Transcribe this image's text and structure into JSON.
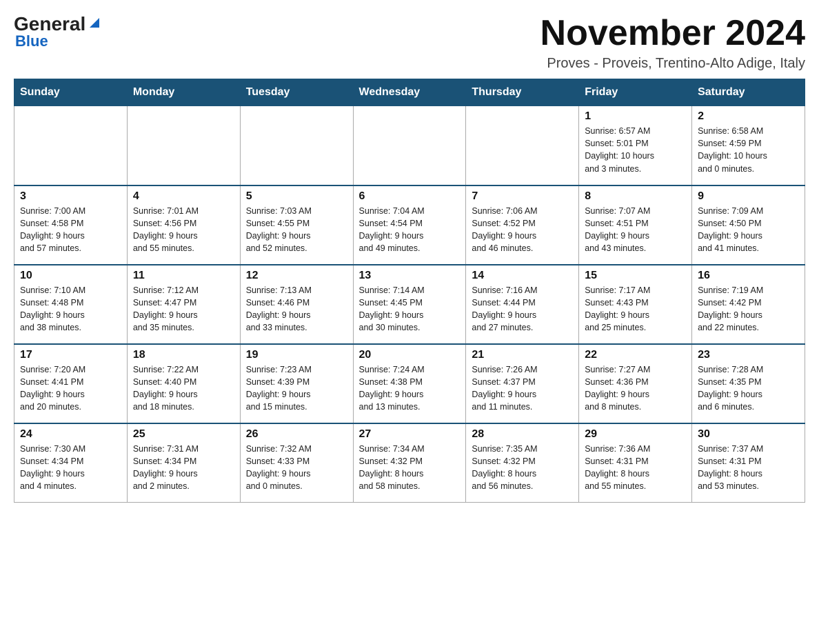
{
  "header": {
    "logo_general": "General",
    "logo_blue": "Blue",
    "month_title": "November 2024",
    "subtitle": "Proves - Proveis, Trentino-Alto Adige, Italy"
  },
  "days_of_week": [
    "Sunday",
    "Monday",
    "Tuesday",
    "Wednesday",
    "Thursday",
    "Friday",
    "Saturday"
  ],
  "weeks": [
    {
      "days": [
        {
          "number": "",
          "info": ""
        },
        {
          "number": "",
          "info": ""
        },
        {
          "number": "",
          "info": ""
        },
        {
          "number": "",
          "info": ""
        },
        {
          "number": "",
          "info": ""
        },
        {
          "number": "1",
          "info": "Sunrise: 6:57 AM\nSunset: 5:01 PM\nDaylight: 10 hours\nand 3 minutes."
        },
        {
          "number": "2",
          "info": "Sunrise: 6:58 AM\nSunset: 4:59 PM\nDaylight: 10 hours\nand 0 minutes."
        }
      ]
    },
    {
      "days": [
        {
          "number": "3",
          "info": "Sunrise: 7:00 AM\nSunset: 4:58 PM\nDaylight: 9 hours\nand 57 minutes."
        },
        {
          "number": "4",
          "info": "Sunrise: 7:01 AM\nSunset: 4:56 PM\nDaylight: 9 hours\nand 55 minutes."
        },
        {
          "number": "5",
          "info": "Sunrise: 7:03 AM\nSunset: 4:55 PM\nDaylight: 9 hours\nand 52 minutes."
        },
        {
          "number": "6",
          "info": "Sunrise: 7:04 AM\nSunset: 4:54 PM\nDaylight: 9 hours\nand 49 minutes."
        },
        {
          "number": "7",
          "info": "Sunrise: 7:06 AM\nSunset: 4:52 PM\nDaylight: 9 hours\nand 46 minutes."
        },
        {
          "number": "8",
          "info": "Sunrise: 7:07 AM\nSunset: 4:51 PM\nDaylight: 9 hours\nand 43 minutes."
        },
        {
          "number": "9",
          "info": "Sunrise: 7:09 AM\nSunset: 4:50 PM\nDaylight: 9 hours\nand 41 minutes."
        }
      ]
    },
    {
      "days": [
        {
          "number": "10",
          "info": "Sunrise: 7:10 AM\nSunset: 4:48 PM\nDaylight: 9 hours\nand 38 minutes."
        },
        {
          "number": "11",
          "info": "Sunrise: 7:12 AM\nSunset: 4:47 PM\nDaylight: 9 hours\nand 35 minutes."
        },
        {
          "number": "12",
          "info": "Sunrise: 7:13 AM\nSunset: 4:46 PM\nDaylight: 9 hours\nand 33 minutes."
        },
        {
          "number": "13",
          "info": "Sunrise: 7:14 AM\nSunset: 4:45 PM\nDaylight: 9 hours\nand 30 minutes."
        },
        {
          "number": "14",
          "info": "Sunrise: 7:16 AM\nSunset: 4:44 PM\nDaylight: 9 hours\nand 27 minutes."
        },
        {
          "number": "15",
          "info": "Sunrise: 7:17 AM\nSunset: 4:43 PM\nDaylight: 9 hours\nand 25 minutes."
        },
        {
          "number": "16",
          "info": "Sunrise: 7:19 AM\nSunset: 4:42 PM\nDaylight: 9 hours\nand 22 minutes."
        }
      ]
    },
    {
      "days": [
        {
          "number": "17",
          "info": "Sunrise: 7:20 AM\nSunset: 4:41 PM\nDaylight: 9 hours\nand 20 minutes."
        },
        {
          "number": "18",
          "info": "Sunrise: 7:22 AM\nSunset: 4:40 PM\nDaylight: 9 hours\nand 18 minutes."
        },
        {
          "number": "19",
          "info": "Sunrise: 7:23 AM\nSunset: 4:39 PM\nDaylight: 9 hours\nand 15 minutes."
        },
        {
          "number": "20",
          "info": "Sunrise: 7:24 AM\nSunset: 4:38 PM\nDaylight: 9 hours\nand 13 minutes."
        },
        {
          "number": "21",
          "info": "Sunrise: 7:26 AM\nSunset: 4:37 PM\nDaylight: 9 hours\nand 11 minutes."
        },
        {
          "number": "22",
          "info": "Sunrise: 7:27 AM\nSunset: 4:36 PM\nDaylight: 9 hours\nand 8 minutes."
        },
        {
          "number": "23",
          "info": "Sunrise: 7:28 AM\nSunset: 4:35 PM\nDaylight: 9 hours\nand 6 minutes."
        }
      ]
    },
    {
      "days": [
        {
          "number": "24",
          "info": "Sunrise: 7:30 AM\nSunset: 4:34 PM\nDaylight: 9 hours\nand 4 minutes."
        },
        {
          "number": "25",
          "info": "Sunrise: 7:31 AM\nSunset: 4:34 PM\nDaylight: 9 hours\nand 2 minutes."
        },
        {
          "number": "26",
          "info": "Sunrise: 7:32 AM\nSunset: 4:33 PM\nDaylight: 9 hours\nand 0 minutes."
        },
        {
          "number": "27",
          "info": "Sunrise: 7:34 AM\nSunset: 4:32 PM\nDaylight: 8 hours\nand 58 minutes."
        },
        {
          "number": "28",
          "info": "Sunrise: 7:35 AM\nSunset: 4:32 PM\nDaylight: 8 hours\nand 56 minutes."
        },
        {
          "number": "29",
          "info": "Sunrise: 7:36 AM\nSunset: 4:31 PM\nDaylight: 8 hours\nand 55 minutes."
        },
        {
          "number": "30",
          "info": "Sunrise: 7:37 AM\nSunset: 4:31 PM\nDaylight: 8 hours\nand 53 minutes."
        }
      ]
    }
  ]
}
